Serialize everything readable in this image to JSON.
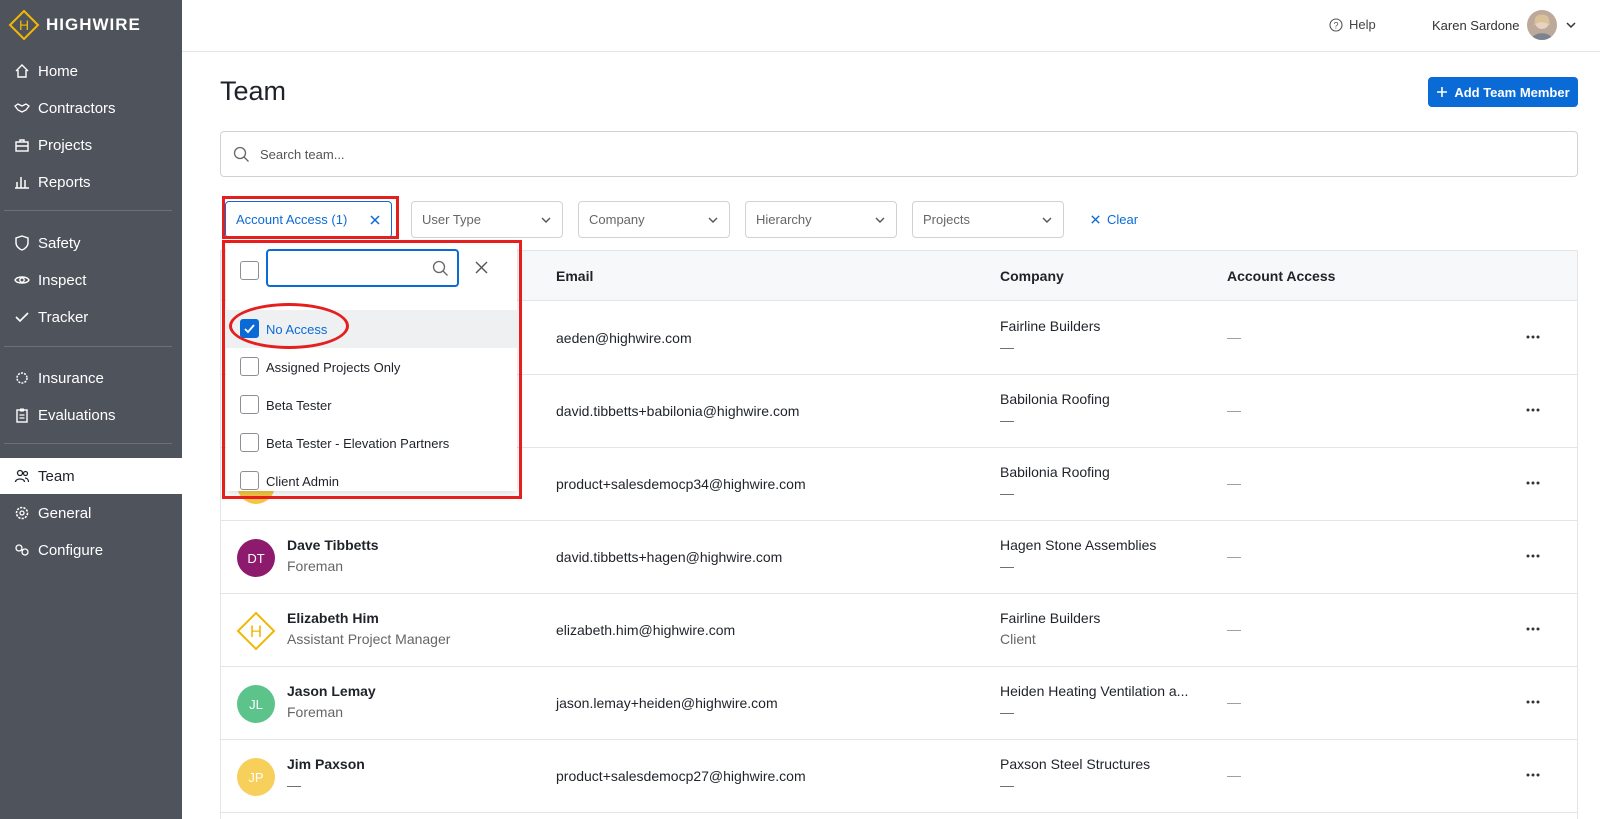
{
  "brand": {
    "name": "HIGHWIRE",
    "color": "#f2b705"
  },
  "sidebar": {
    "items": [
      {
        "label": "Home",
        "icon": "home-icon"
      },
      {
        "label": "Contractors",
        "icon": "handshake-icon"
      },
      {
        "label": "Projects",
        "icon": "briefcase-icon"
      },
      {
        "label": "Reports",
        "icon": "bar-chart-icon"
      },
      {
        "label": "Safety",
        "icon": "shield-icon"
      },
      {
        "label": "Inspect",
        "icon": "eye-icon"
      },
      {
        "label": "Tracker",
        "icon": "check-icon"
      },
      {
        "label": "Insurance",
        "icon": "gear-outline-icon"
      },
      {
        "label": "Evaluations",
        "icon": "clipboard-icon"
      },
      {
        "label": "Team",
        "icon": "users-icon"
      },
      {
        "label": "General",
        "icon": "cog-icon"
      },
      {
        "label": "Configure",
        "icon": "link-icon"
      }
    ]
  },
  "topbar": {
    "help_label": "Help",
    "user_name": "Karen Sardone"
  },
  "page": {
    "title": "Team",
    "add_button_label": "Add Team Member"
  },
  "search": {
    "placeholder": "Search team..."
  },
  "filters": {
    "account_access": "Account Access (1)",
    "user_type": "User Type",
    "company": "Company",
    "hierarchy": "Hierarchy",
    "projects": "Projects",
    "clear_label": "Clear"
  },
  "dropdown": {
    "search_value": "",
    "options": [
      {
        "label": "No Access",
        "checked": true
      },
      {
        "label": "Assigned Projects Only",
        "checked": false
      },
      {
        "label": "Beta Tester",
        "checked": false
      },
      {
        "label": "Beta Tester - Elevation Partners",
        "checked": false
      },
      {
        "label": "Client Admin",
        "checked": false
      }
    ]
  },
  "table": {
    "columns": {
      "email": "Email",
      "company": "Company",
      "account_access": "Account Access"
    },
    "rows": [
      {
        "name": "",
        "role": "",
        "initials": "",
        "avatar_color": "",
        "email": "aeden@highwire.com",
        "company": "Fairline Builders",
        "company_sub": "—",
        "access": "—"
      },
      {
        "name": "",
        "role": "",
        "initials": "",
        "avatar_color": "",
        "email": "david.tibbetts+babilonia@highwire.com",
        "company": "Babilonia Roofing",
        "company_sub": "—",
        "access": "—"
      },
      {
        "name": "",
        "role": "",
        "initials": "",
        "avatar_color": "#f5c542",
        "email": "product+salesdemocp34@highwire.com",
        "company": "Babilonia Roofing",
        "company_sub": "—",
        "access": "—"
      },
      {
        "name": "Dave Tibbetts",
        "role": "Foreman",
        "initials": "DT",
        "avatar_color": "#8e1a6e",
        "email": "david.tibbetts+hagen@highwire.com",
        "company": "Hagen Stone Assemblies",
        "company_sub": "—",
        "access": "—"
      },
      {
        "name": "Elizabeth Him",
        "role": "Assistant Project Manager",
        "initials": "",
        "avatar_color": "logo",
        "email": "elizabeth.him@highwire.com",
        "company": "Fairline Builders",
        "company_sub": "Client",
        "access": "—"
      },
      {
        "name": "Jason Lemay",
        "role": "Foreman",
        "initials": "JL",
        "avatar_color": "#5cc38a",
        "email": "jason.lemay+heiden@highwire.com",
        "company": "Heiden Heating Ventilation a...",
        "company_sub": "—",
        "access": "—"
      },
      {
        "name": "Jim Paxson",
        "role": "—",
        "initials": "JP",
        "avatar_color": "#f7cf5b",
        "email": "product+salesdemocp27@highwire.com",
        "company": "Paxson Steel Structures",
        "company_sub": "—",
        "access": "—"
      }
    ]
  }
}
